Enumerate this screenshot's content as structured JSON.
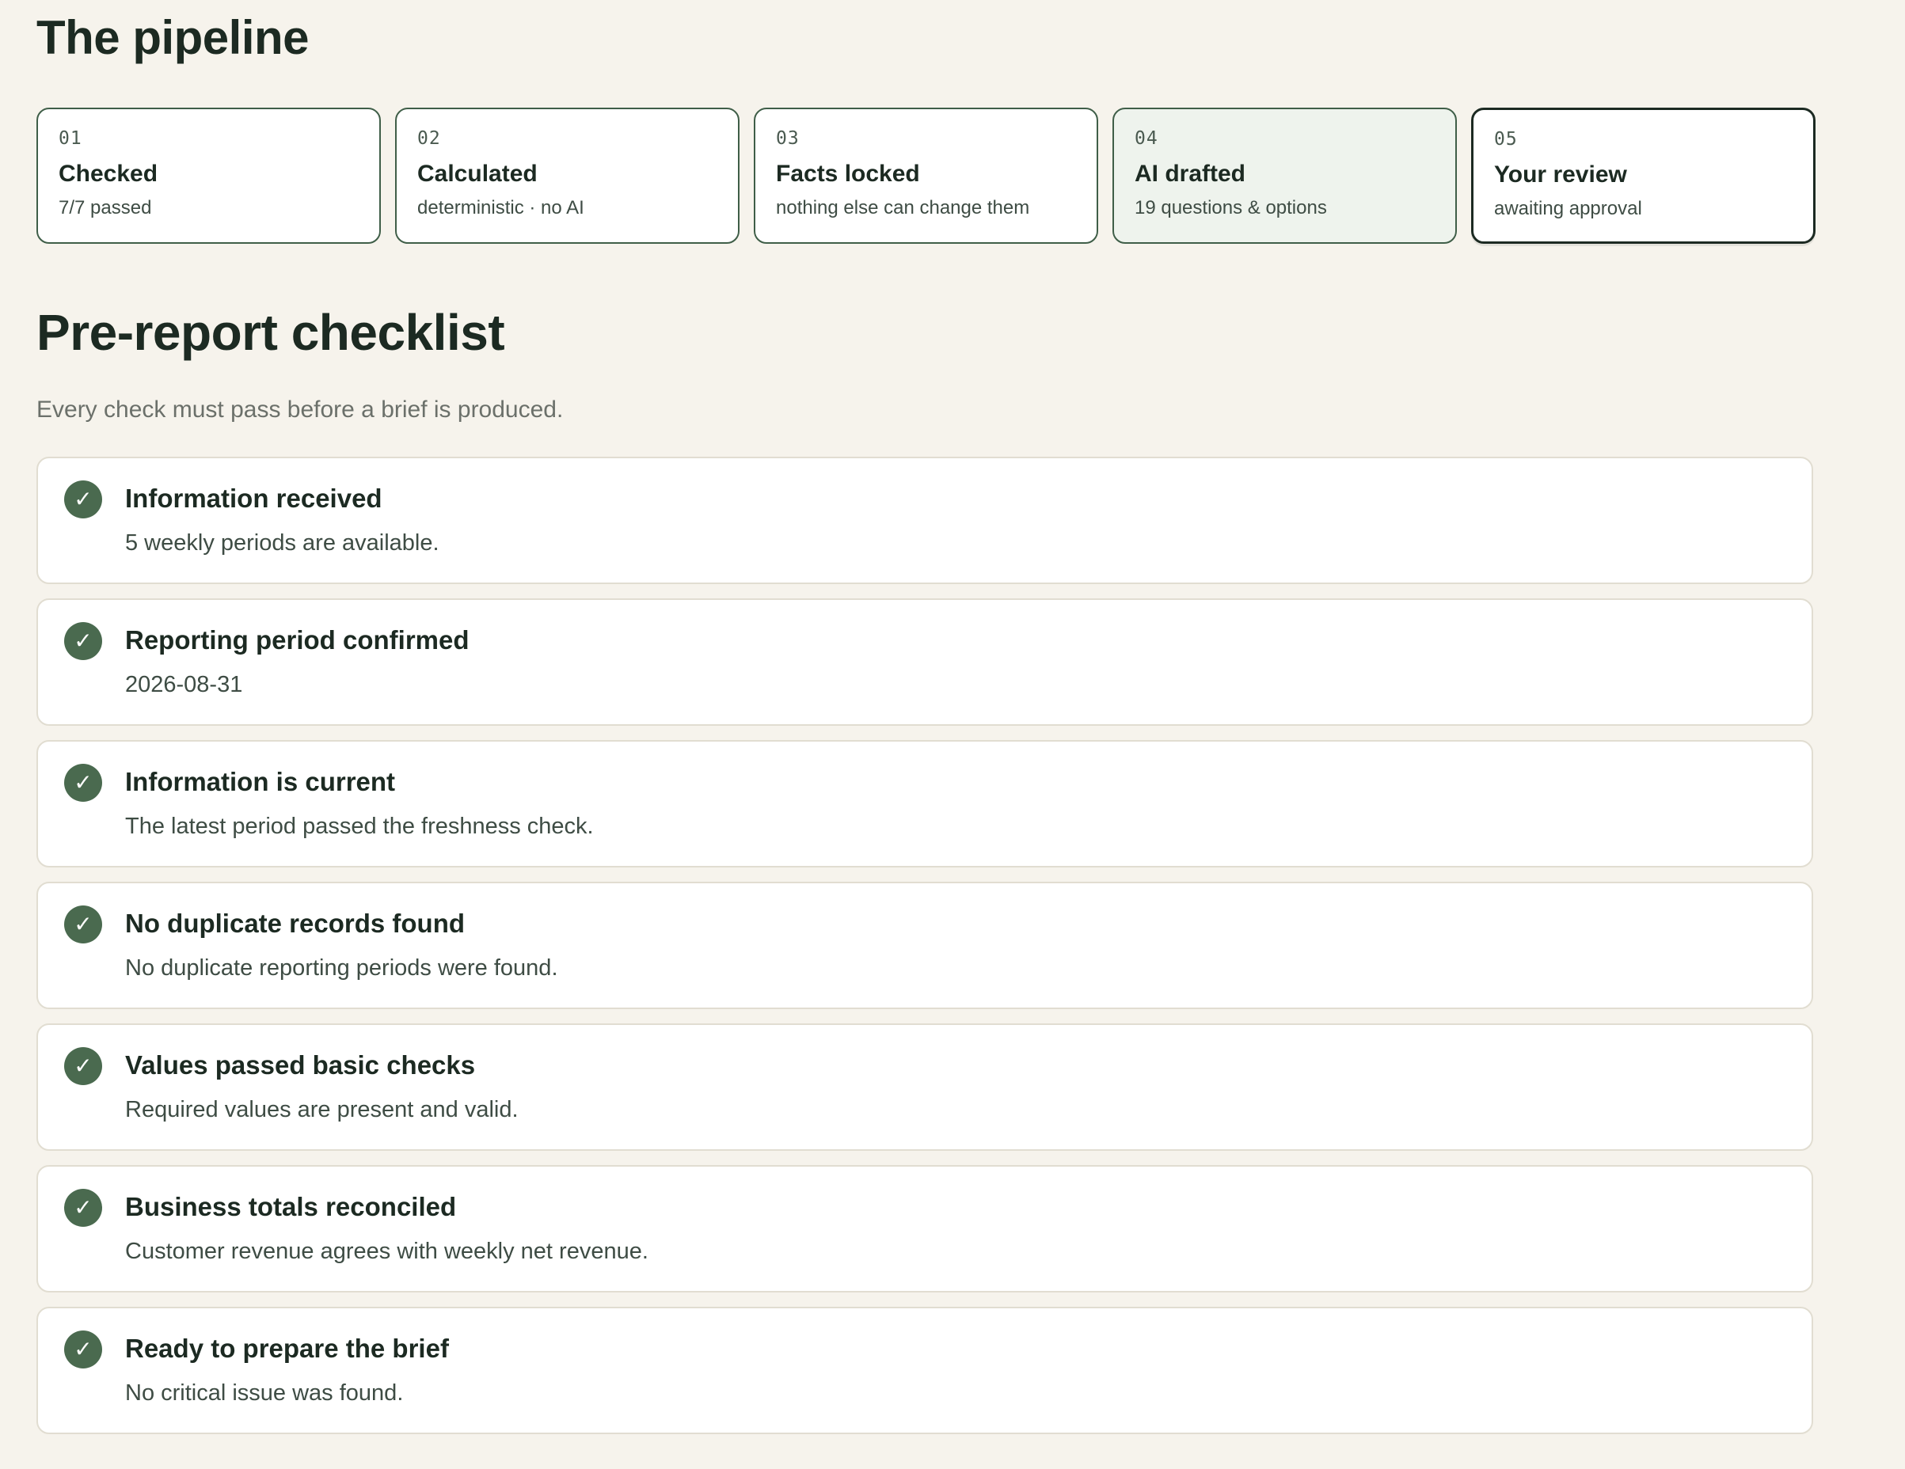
{
  "pipeline": {
    "title": "The pipeline",
    "stages": [
      {
        "num": "01",
        "title": "Checked",
        "sub": "7/7 passed"
      },
      {
        "num": "02",
        "title": "Calculated",
        "sub": "deterministic · no AI"
      },
      {
        "num": "03",
        "title": "Facts locked",
        "sub": "nothing else can change them"
      },
      {
        "num": "04",
        "title": "AI drafted",
        "sub": "19 questions & options"
      },
      {
        "num": "05",
        "title": "Your review",
        "sub": "awaiting approval"
      }
    ]
  },
  "checklist": {
    "title": "Pre-report checklist",
    "description": "Every check must pass before a brief is produced.",
    "check_icon": "check-icon",
    "items": [
      {
        "title": "Information received",
        "detail": "5 weekly periods are available."
      },
      {
        "title": "Reporting period confirmed",
        "detail": "2026-08-31"
      },
      {
        "title": "Information is current",
        "detail": "The latest period passed the freshness check."
      },
      {
        "title": "No duplicate records found",
        "detail": "No duplicate reporting periods were found."
      },
      {
        "title": "Values passed basic checks",
        "detail": "Required values are present and valid."
      },
      {
        "title": "Business totals reconciled",
        "detail": "Customer revenue agrees with weekly net revenue."
      },
      {
        "title": "Ready to prepare the brief",
        "detail": "No critical issue was found."
      }
    ]
  },
  "colors": {
    "background": "#f6f3ec",
    "accent": "#4a6a4f",
    "text": "#1c2a22"
  }
}
